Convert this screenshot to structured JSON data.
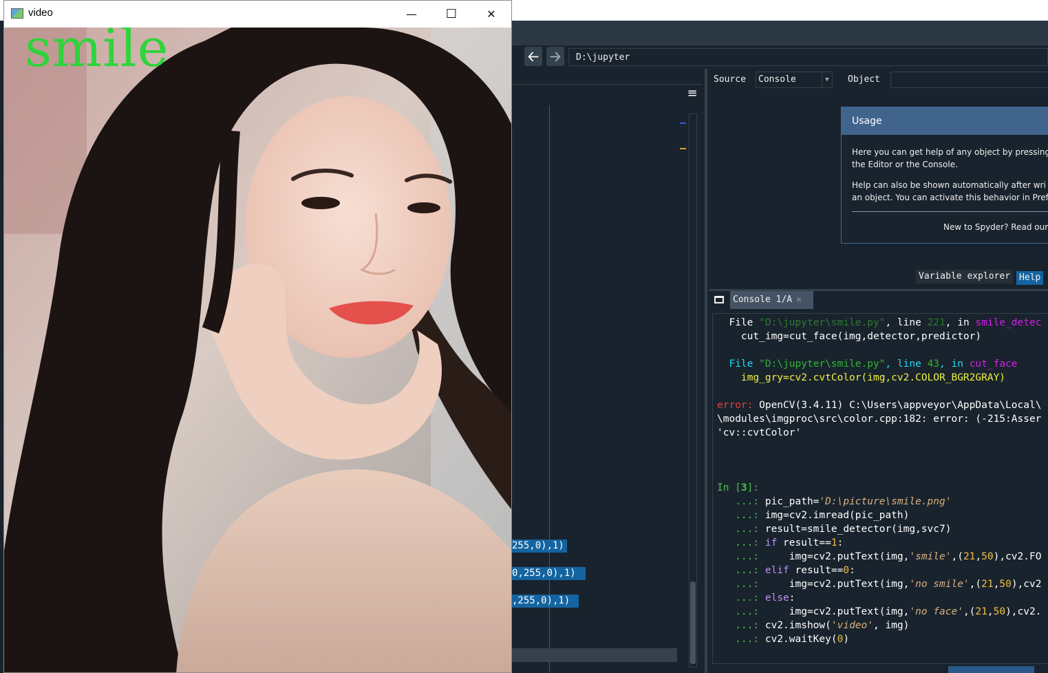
{
  "video_window": {
    "title": "video",
    "overlay_text": "smile",
    "minimize_glyph": "—",
    "maximize_glyph": "☐",
    "close_glyph": "✕",
    "overlay_color": "#2fd43a"
  },
  "spyder": {
    "path": "D:\\jupyter",
    "back_glyph": "🡠",
    "forward_glyph": "🡢",
    "editor_menu_glyph": "≡",
    "editor_selections": [
      "255,0),1)",
      "0,255,0),1)",
      ",255,0),1)"
    ],
    "help": {
      "source_label": "Source",
      "source_value": "Console",
      "object_label": "Object",
      "usage_title": "Usage",
      "usage_line1": "Here you can get help of any object by pressing",
      "usage_line2": "the Editor or the Console.",
      "usage_line3": "Help can also be shown automatically after wri",
      "usage_line4": "an object. You can activate this behavior in Pref",
      "usage_new": "New to Spyder? Read our",
      "tab_variable_explorer": "Variable explorer",
      "tab_help": "Help"
    },
    "console": {
      "tab_label": "Console 1/A",
      "tab_close": "✕",
      "lines": {
        "file1_prefix": "File ",
        "file1_path": "\"D:\\jupyter\\smile.py\"",
        "file1_mid": ", line ",
        "file1_line": "221",
        "file1_in": ", in ",
        "file1_func": "smile_detec",
        "code1": "cut_img=cut_face(img,detector,predictor)",
        "file2_prefix": "File ",
        "file2_path": "\"D:\\jupyter\\smile.py\"",
        "file2_mid": ", line ",
        "file2_line": "43",
        "file2_in": ", in ",
        "file2_func": "cut_face",
        "code2": "img_gry=cv2.cvtColor(img,cv2.COLOR_BGR2GRAY)",
        "err_label": "error:",
        "err_text": " OpenCV(3.4.11) C:\\Users\\appveyor\\AppData\\Local\\",
        "err_text2": "\\modules\\imgproc\\src\\color.cpp:182: error: (-215:Asser",
        "err_text3": "'cv::cvtColor'",
        "prompt": "In [",
        "prompt_num": "3",
        "prompt_end": "]:",
        "cont": "   ...: "
      }
    }
  }
}
